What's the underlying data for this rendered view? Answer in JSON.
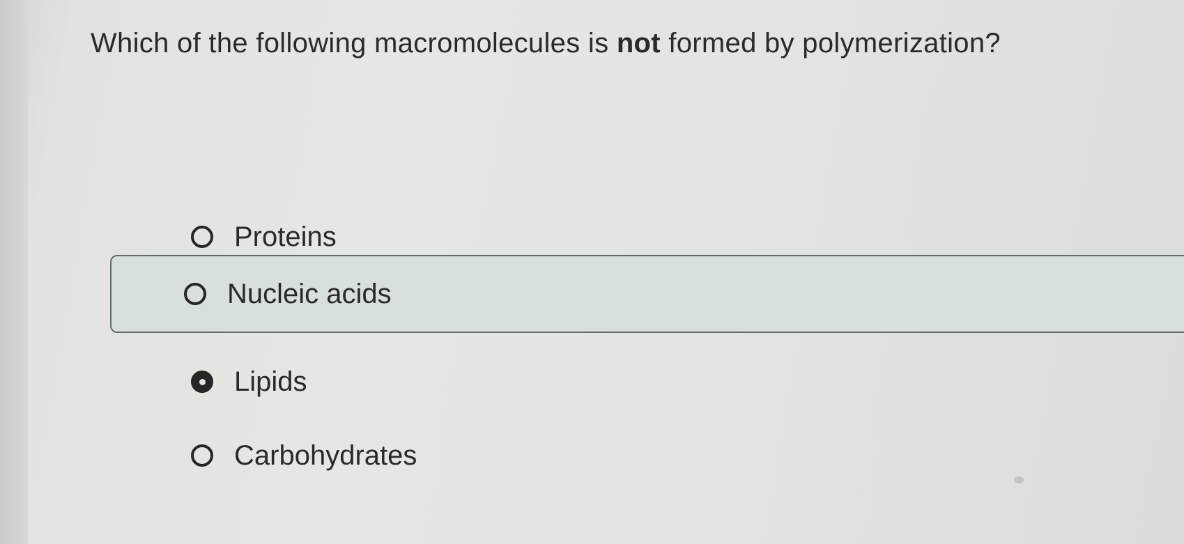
{
  "question": {
    "prefix": "Which of the following macromolecules is ",
    "emphasis": "not",
    "suffix": " formed by polymerization?"
  },
  "options": [
    {
      "label": "Proteins",
      "selected": false,
      "highlighted": false
    },
    {
      "label": "Nucleic acids",
      "selected": false,
      "highlighted": true
    },
    {
      "label": "Lipids",
      "selected": true,
      "highlighted": false
    },
    {
      "label": "Carbohydrates",
      "selected": false,
      "highlighted": false
    }
  ],
  "colors": {
    "background": "#e4e4e1",
    "highlight_bg": "#d7e0dd",
    "highlight_border": "#5f6d6a",
    "text": "#2a2a2a"
  }
}
